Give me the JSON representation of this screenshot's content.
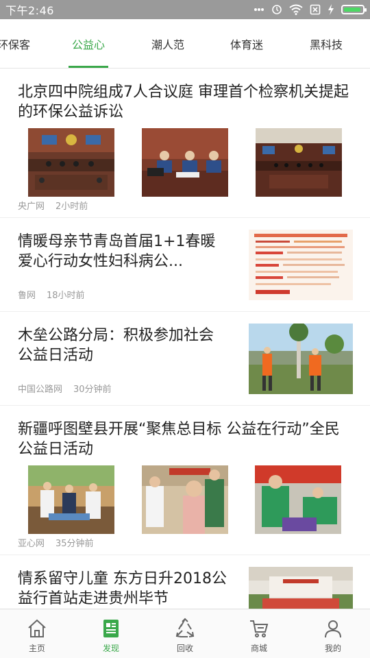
{
  "status_bar": {
    "time": "下午2:46"
  },
  "tabs": [
    {
      "label": "环保客",
      "active": false
    },
    {
      "label": "公益心",
      "active": true
    },
    {
      "label": "潮人范",
      "active": false
    },
    {
      "label": "体育迷",
      "active": false
    },
    {
      "label": "黑科技",
      "active": false
    }
  ],
  "articles": [
    {
      "title": "北京四中院组成7人合议庭 审理首个检察机关提起的环保公益诉讼",
      "source": "央广网",
      "time": "2小时前"
    },
    {
      "title": "情暖母亲节青岛首届1+1春暖爱心行动女性妇科病公...",
      "source": "鲁网",
      "time": "18小时前"
    },
    {
      "title": "木垒公路分局：积极参加社会公益日活动",
      "source": "中国公路网",
      "time": "30分钟前"
    },
    {
      "title": "新疆呼图壁县开展“聚焦总目标 公益在行动”全民公益日活动",
      "source": "亚心网",
      "time": "35分钟前"
    },
    {
      "title": "情系留守儿童 东方日升2018公益行首站走进贵州毕节",
      "source": "",
      "time": ""
    }
  ],
  "bottom_nav": [
    {
      "label": "主页",
      "icon": "home-icon",
      "active": false
    },
    {
      "label": "发现",
      "icon": "discover-icon",
      "active": true
    },
    {
      "label": "回收",
      "icon": "recycle-icon",
      "active": false
    },
    {
      "label": "商城",
      "icon": "cart-icon",
      "active": false
    },
    {
      "label": "我的",
      "icon": "user-icon",
      "active": false
    }
  ],
  "colors": {
    "accent": "#3aa84a",
    "status_bar": "#9a9a9a",
    "battery": "#4cd964"
  }
}
